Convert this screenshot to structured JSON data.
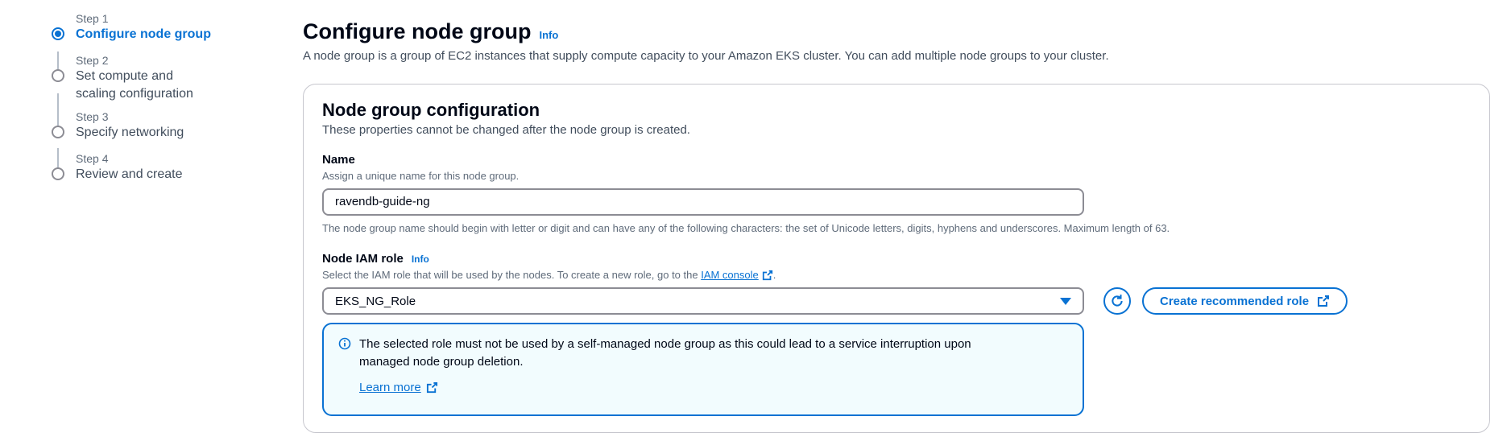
{
  "wizard": {
    "steps": [
      {
        "number": "Step 1",
        "title": "Configure node group",
        "active": true
      },
      {
        "number": "Step 2",
        "title": "Set compute and scaling configuration",
        "active": false
      },
      {
        "number": "Step 3",
        "title": "Specify networking",
        "active": false
      },
      {
        "number": "Step 4",
        "title": "Review and create",
        "active": false
      }
    ]
  },
  "header": {
    "title": "Configure node group",
    "info_label": "Info",
    "description": "A node group is a group of EC2 instances that supply compute capacity to your Amazon EKS cluster. You can add multiple node groups to your cluster."
  },
  "config": {
    "title": "Node group configuration",
    "description": "These properties cannot be changed after the node group is created.",
    "name_field": {
      "label": "Name",
      "description": "Assign a unique name for this node group.",
      "value": "ravendb-guide-ng",
      "constraint": "The node group name should begin with letter or digit and can have any of the following characters: the set of Unicode letters, digits, hyphens and underscores. Maximum length of 63."
    },
    "iam_role": {
      "label": "Node IAM role",
      "info_label": "Info",
      "description_prefix": "Select the IAM role that will be used by the nodes. To create a new role, go to the ",
      "description_link": "IAM console",
      "description_suffix": ".",
      "selected_value": "EKS_NG_Role",
      "create_button_label": "Create recommended role"
    },
    "alert": {
      "message": "The selected role must not be used by a self-managed node group as this could lead to a service interruption upon managed node group deletion.",
      "link_label": "Learn more"
    }
  },
  "colors": {
    "accent": "#0972d3",
    "alert_background": "#f2fcfe",
    "border": "#8c8c94"
  }
}
